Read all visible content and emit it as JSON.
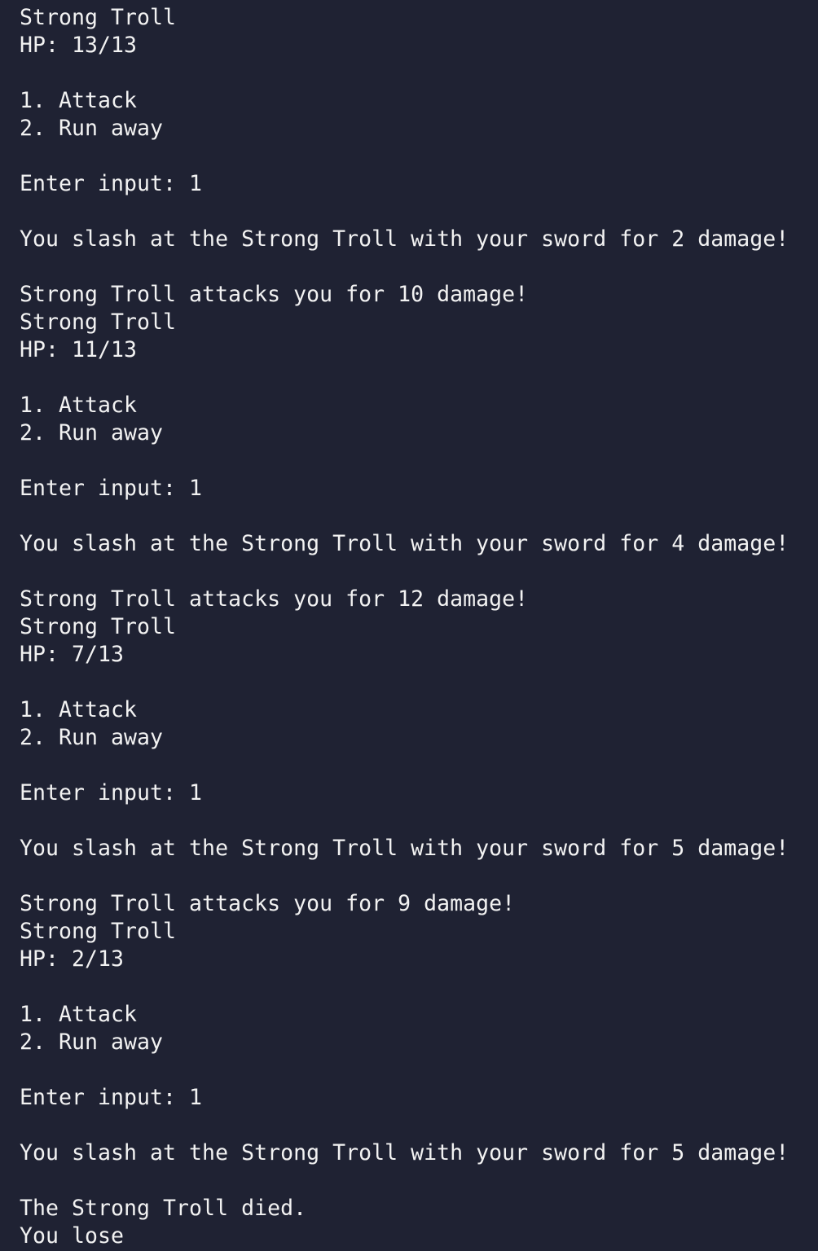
{
  "colors": {
    "background": "#1f2233",
    "text": "#f2f2f2"
  },
  "terminal": {
    "lines": [
      "Strong Troll",
      "HP: 13/13",
      "",
      "1. Attack",
      "2. Run away",
      "",
      "Enter input: 1",
      "",
      "You slash at the Strong Troll with your sword for 2 damage!",
      "",
      "Strong Troll attacks you for 10 damage!",
      "Strong Troll",
      "HP: 11/13",
      "",
      "1. Attack",
      "2. Run away",
      "",
      "Enter input: 1",
      "",
      "You slash at the Strong Troll with your sword for 4 damage!",
      "",
      "Strong Troll attacks you for 12 damage!",
      "Strong Troll",
      "HP: 7/13",
      "",
      "1. Attack",
      "2. Run away",
      "",
      "Enter input: 1",
      "",
      "You slash at the Strong Troll with your sword for 5 damage!",
      "",
      "Strong Troll attacks you for 9 damage!",
      "Strong Troll",
      "HP: 2/13",
      "",
      "1. Attack",
      "2. Run away",
      "",
      "Enter input: 1",
      "",
      "You slash at the Strong Troll with your sword for 5 damage!",
      "",
      "The Strong Troll died.",
      "You lose"
    ]
  }
}
